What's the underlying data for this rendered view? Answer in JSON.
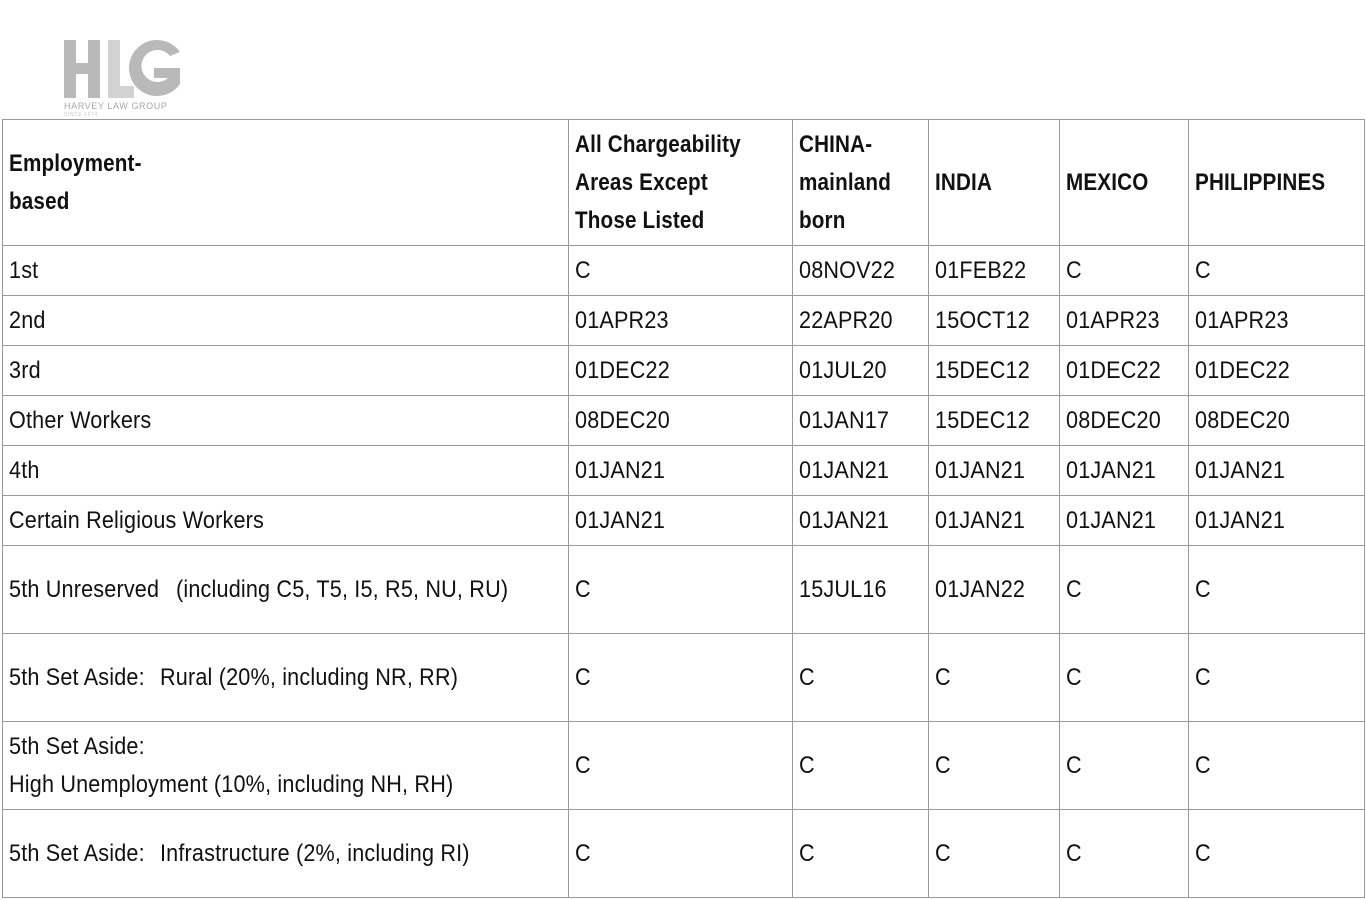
{
  "logo": {
    "mark": "HLG",
    "caption": "HARVEY LAW GROUP",
    "since": "SINCE 1974"
  },
  "table": {
    "headers": [
      "Employment-based",
      "All Chargeability Areas Except Those Listed",
      "CHINA-mainland born",
      "INDIA",
      "MEXICO",
      "PHILIPPINES"
    ],
    "rows": [
      {
        "category": [
          "1st"
        ],
        "values": [
          "C",
          "08NOV22",
          "01FEB22",
          "C",
          "C"
        ]
      },
      {
        "category": [
          "2nd"
        ],
        "values": [
          "01APR23",
          "22APR20",
          "15OCT12",
          "01APR23",
          "01APR23"
        ]
      },
      {
        "category": [
          "3rd"
        ],
        "values": [
          "01DEC22",
          "01JUL20",
          "15DEC12",
          "01DEC22",
          "01DEC22"
        ]
      },
      {
        "category": [
          "Other Workers"
        ],
        "values": [
          "08DEC20",
          "01JAN17",
          "15DEC12",
          "08DEC20",
          "08DEC20"
        ]
      },
      {
        "category": [
          "4th"
        ],
        "values": [
          "01JAN21",
          "01JAN21",
          "01JAN21",
          "01JAN21",
          "01JAN21"
        ]
      },
      {
        "category": [
          "Certain Religious Workers"
        ],
        "values": [
          "01JAN21",
          "01JAN21",
          "01JAN21",
          "01JAN21",
          "01JAN21"
        ]
      },
      {
        "category": [
          "5th Unreserved",
          "(including C5, T5, I5, R5, NU, RU)"
        ],
        "values": [
          "C",
          "15JUL16",
          "01JAN22",
          "C",
          "C"
        ]
      },
      {
        "category": [
          "5th Set Aside:",
          "Rural (20%, including NR, RR)"
        ],
        "values": [
          "C",
          "C",
          "C",
          "C",
          "C"
        ]
      },
      {
        "category": [
          "5th Set Aside:",
          "High Unemployment (10%, including NH, RH)"
        ],
        "values": [
          "C",
          "C",
          "C",
          "C",
          "C"
        ]
      },
      {
        "category": [
          "5th Set Aside:",
          "Infrastructure (2%, including RI)"
        ],
        "values": [
          "C",
          "C",
          "C",
          "C",
          "C"
        ]
      }
    ]
  }
}
